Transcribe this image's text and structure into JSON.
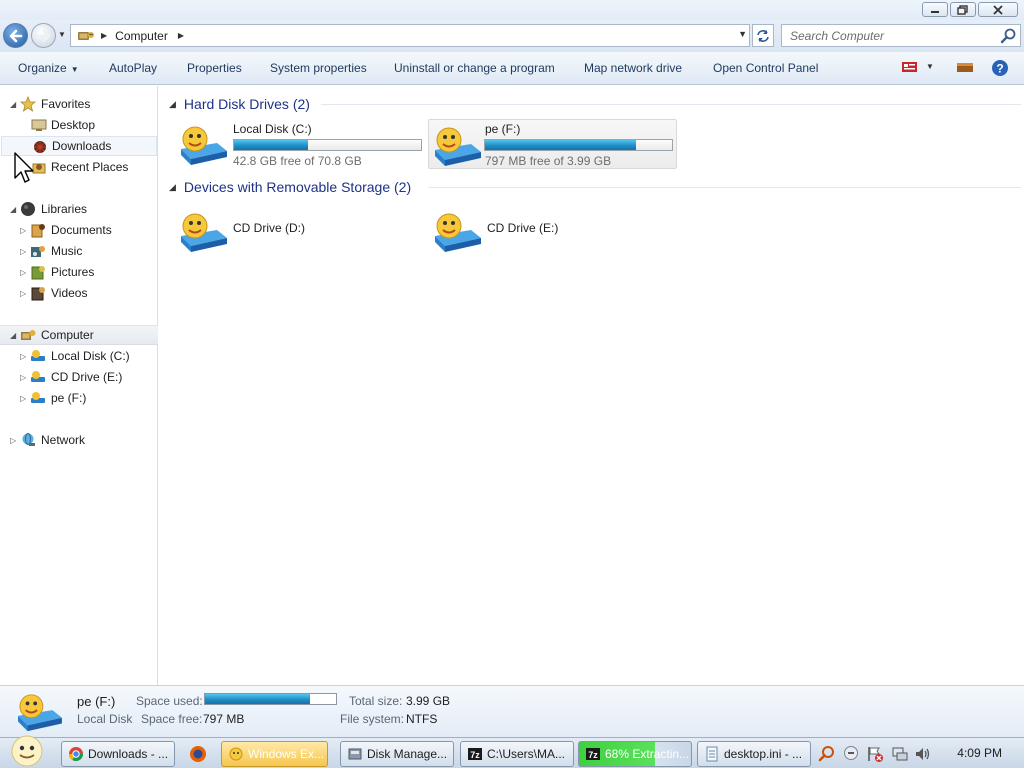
{
  "address": {
    "path": [
      "Computer"
    ],
    "search_placeholder": "Search Computer"
  },
  "toolbar": {
    "organize_label": "Organize",
    "autoplay_label": "AutoPlay",
    "properties_label": "Properties",
    "system_properties_label": "System properties",
    "uninstall_label": "Uninstall or change a program",
    "map_network_label": "Map network drive",
    "control_panel_label": "Open Control Panel"
  },
  "sidebar": {
    "favorites": {
      "label": "Favorites",
      "items": [
        {
          "label": "Desktop",
          "icon": "desktop-icon"
        },
        {
          "label": "Downloads",
          "icon": "downloads-icon"
        },
        {
          "label": "Recent Places",
          "icon": "recent-places-icon"
        }
      ]
    },
    "libraries": {
      "label": "Libraries",
      "items": [
        {
          "label": "Documents",
          "icon": "documents-icon"
        },
        {
          "label": "Music",
          "icon": "music-icon"
        },
        {
          "label": "Pictures",
          "icon": "pictures-icon"
        },
        {
          "label": "Videos",
          "icon": "videos-icon"
        }
      ]
    },
    "computer": {
      "label": "Computer",
      "items": [
        {
          "label": "Local Disk (C:)",
          "icon": "drive-icon"
        },
        {
          "label": "CD Drive (E:)",
          "icon": "drive-icon"
        },
        {
          "label": "pe (F:)",
          "icon": "drive-icon"
        }
      ]
    },
    "network": {
      "label": "Network"
    }
  },
  "content": {
    "hard_disks": {
      "header": "Hard Disk Drives (2)",
      "drives": [
        {
          "name": "Local Disk (C:)",
          "free_text": "42.8 GB free of 70.8 GB",
          "used_fraction": 0.395
        },
        {
          "name": "pe (F:)",
          "free_text": "797 MB free of 3.99 GB",
          "used_fraction": 0.805
        }
      ]
    },
    "removable": {
      "header": "Devices with Removable Storage (2)",
      "drives": [
        {
          "name": "CD Drive (D:)"
        },
        {
          "name": "CD Drive (E:)"
        }
      ]
    }
  },
  "details": {
    "name": "pe (F:)",
    "type": "Local Disk",
    "space_used_label": "Space used:",
    "space_used_fraction": 0.805,
    "space_free_label": "Space free:",
    "space_free_value": "797 MB",
    "total_size_label": "Total size:",
    "total_size_value": "3.99 GB",
    "file_system_label": "File system:",
    "file_system_value": "NTFS"
  },
  "taskbar": {
    "buttons": [
      {
        "label": "Downloads - ...",
        "icon": "chrome-icon"
      },
      {
        "label": "Windows Ex...",
        "icon": "explorer-icon"
      },
      {
        "label": "Disk Manage...",
        "icon": "disk-management-icon"
      },
      {
        "label": "C:\\Users\\MA...",
        "icon": "sevenzip-icon"
      },
      {
        "label": "68% Extractin...",
        "icon": "sevenzip-icon",
        "progress": 0.68
      },
      {
        "label": "desktop.ini - ...",
        "icon": "notepad-icon"
      }
    ],
    "clock": "4:09 PM"
  },
  "colors": {
    "accent_blue": "#1e3287",
    "bar_fill": "#1f8fc7",
    "command_text": "#1e395b",
    "muted_text": "#6d6d6d"
  }
}
